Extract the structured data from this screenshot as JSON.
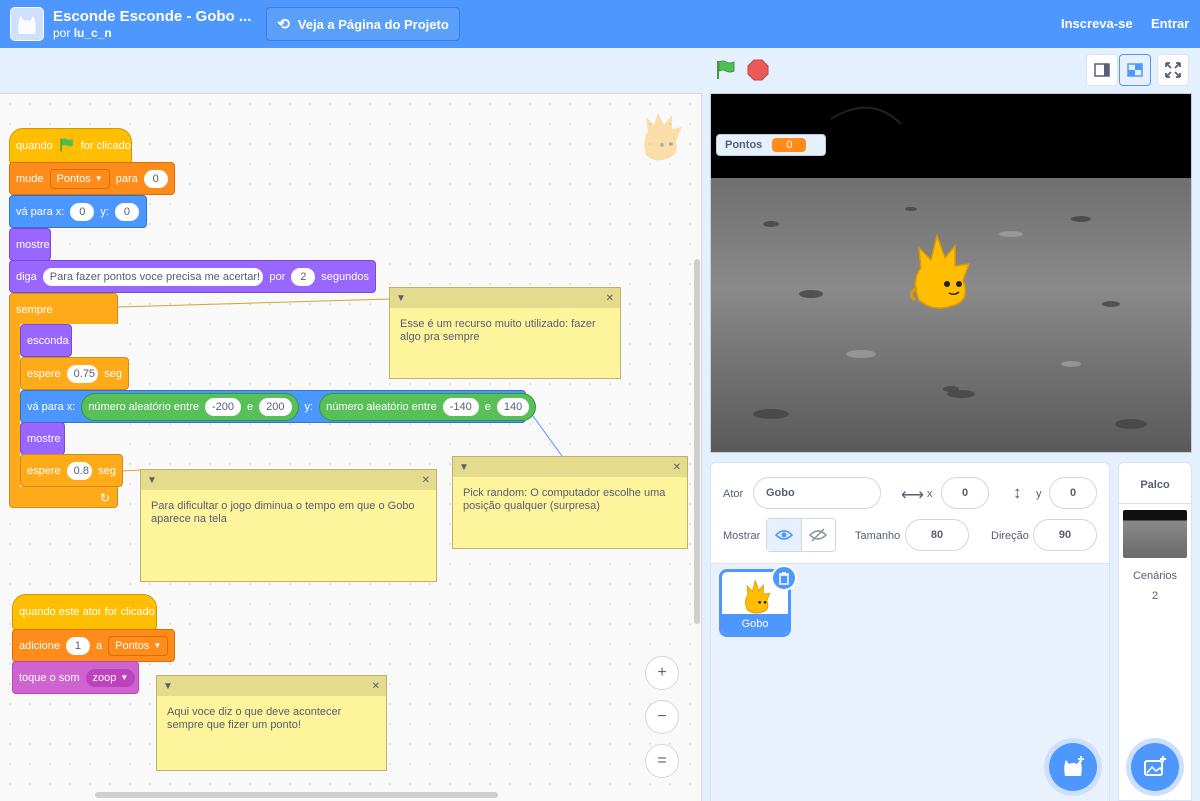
{
  "header": {
    "title": "Esconde Esconde - Gobo ...",
    "by_prefix": "por",
    "author": "lu_c_n",
    "project_button": "Veja a Página do Projeto",
    "signup": "Inscreva-se",
    "signin": "Entrar"
  },
  "scripts": {
    "when_flag_pre": "quando",
    "when_flag_post": "for clicado",
    "set_var": "mude",
    "set_var_name": "Pontos",
    "set_var_to": "para",
    "set_var_value": "0",
    "goto_label": "vá para x:",
    "goto_x": "0",
    "goto_y_label": "y:",
    "goto_y": "0",
    "show": "mostre",
    "say": "diga",
    "say_text": "Para fazer pontos voce precisa me acertar!",
    "say_for": "por",
    "say_secs": "2",
    "say_secs_label": "segundos",
    "forever": "sempre",
    "hide": "esconda",
    "wait": "espere",
    "wait1_value": "0.75",
    "wait_unit": "seg",
    "goto2_label": "vá para x:",
    "random_label": "número aleatório entre",
    "random_and": "e",
    "rand_x_min": "-200",
    "rand_x_max": "200",
    "goto2_y_label": "y:",
    "rand_y_min": "-140",
    "rand_y_max": "140",
    "show2": "mostre",
    "wait2_value": "0.8",
    "when_clicked": "quando este ator for clicado",
    "change_var": "adicione",
    "change_var_value": "1",
    "change_var_to": "a",
    "change_var_name": "Pontos",
    "play_sound": "toque o som",
    "sound_name": "zoop"
  },
  "notes": {
    "forever_note": "Esse é um recurso muito utilizado: fazer algo pra sempre",
    "wait_note": "Para dificultar o jogo diminua o tempo em que o Gobo aparece na tela",
    "random_note": "Pick random: O computador escolhe uma posição qualquer (surpresa)",
    "click_note": "Aqui voce diz o que deve acontecer sempre que fizer um ponto!"
  },
  "zoom": {
    "in": "+",
    "out": "−",
    "reset": "="
  },
  "stage": {
    "monitor_label": "Pontos",
    "monitor_value": "0"
  },
  "sprite_info": {
    "sprite_label": "Ator",
    "sprite_name": "Gobo",
    "x_label": "x",
    "x_value": "0",
    "y_label": "y",
    "y_value": "0",
    "show_label": "Mostrar",
    "size_label": "Tamanho",
    "size_value": "80",
    "direction_label": "Direção",
    "direction_value": "90",
    "tile_name": "Gobo"
  },
  "stage_panel": {
    "title": "Palco",
    "backdrops_label": "Cenários",
    "backdrops_count": "2"
  },
  "colors": {
    "header": "#4d97ff",
    "events": "#ffbf00",
    "variables": "#ff8c1a",
    "motion": "#4c97ff",
    "looks": "#9966ff",
    "control": "#ffab19",
    "sound": "#cf63cf",
    "operators": "#59c059",
    "note": "#fef49c"
  },
  "icons": [
    "cat-logo-icon",
    "remix-icon",
    "green-flag-icon",
    "stop-icon",
    "small-stage-icon",
    "normal-stage-icon",
    "fullscreen-icon",
    "zoom-in-icon",
    "zoom-out-icon",
    "zoom-reset-icon",
    "eye-icon",
    "eye-off-icon",
    "trash-icon",
    "add-sprite-icon",
    "add-backdrop-icon"
  ]
}
